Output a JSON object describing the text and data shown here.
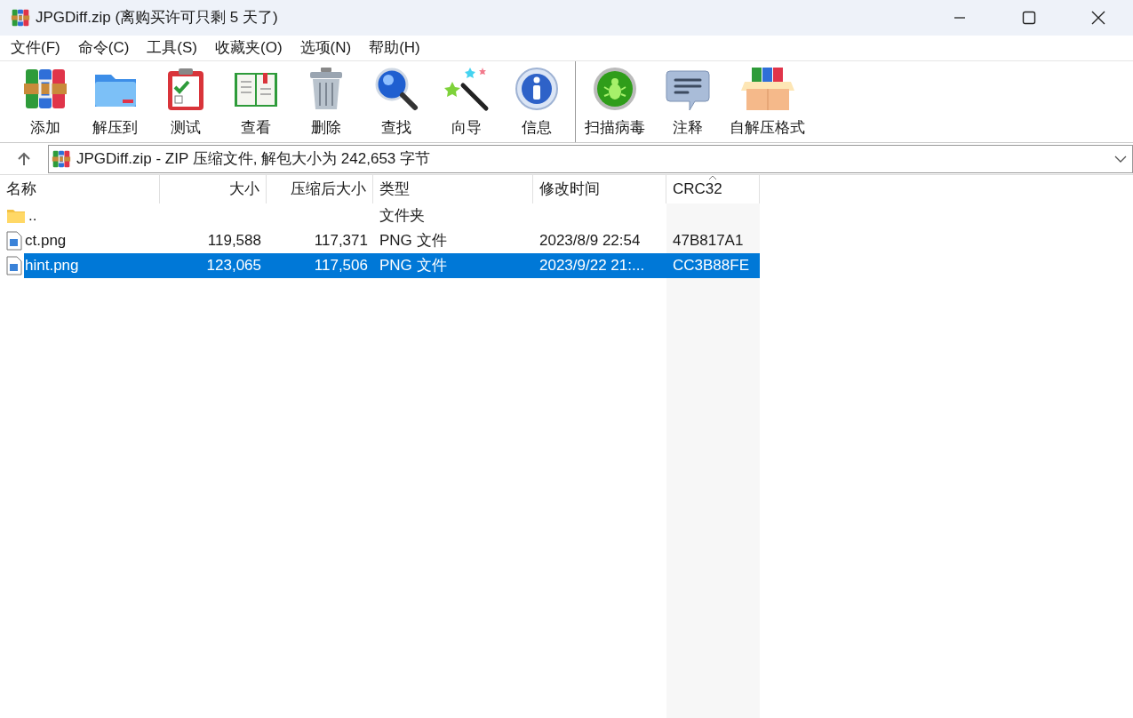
{
  "window": {
    "title": "JPGDiff.zip (离购买许可只剩 5 天了)"
  },
  "menu": [
    "文件(F)",
    "命令(C)",
    "工具(S)",
    "收藏夹(O)",
    "选项(N)",
    "帮助(H)"
  ],
  "toolbar_groups": [
    {
      "buttons": [
        {
          "label": "添加",
          "kind": "add"
        },
        {
          "label": "解压到",
          "kind": "extract"
        },
        {
          "label": "测试",
          "kind": "test"
        },
        {
          "label": "查看",
          "kind": "view"
        },
        {
          "label": "删除",
          "kind": "delete"
        },
        {
          "label": "查找",
          "kind": "find"
        },
        {
          "label": "向导",
          "kind": "wizard"
        },
        {
          "label": "信息",
          "kind": "info"
        }
      ]
    },
    {
      "buttons": [
        {
          "label": "扫描病毒",
          "kind": "virus"
        },
        {
          "label": "注释",
          "kind": "comment"
        },
        {
          "label": "自解压格式",
          "kind": "sfx"
        }
      ]
    }
  ],
  "address": {
    "text": "JPGDiff.zip - ZIP 压缩文件, 解包大小为 242,653 字节"
  },
  "table": {
    "columns": [
      {
        "label": "名称",
        "sorted": false
      },
      {
        "label": "大小",
        "sorted": false
      },
      {
        "label": "压缩后大小",
        "sorted": false
      },
      {
        "label": "类型",
        "sorted": false
      },
      {
        "label": "修改时间",
        "sorted": false
      },
      {
        "label": "CRC32",
        "sorted": true
      }
    ],
    "rows": [
      {
        "kind": "folder",
        "selected": false,
        "cells": [
          "..",
          "",
          "",
          "文件夹",
          "",
          ""
        ]
      },
      {
        "kind": "file",
        "selected": false,
        "cells": [
          "ct.png",
          "119,588",
          "117,371",
          "PNG 文件",
          "2023/8/9 22:54",
          "47B817A1"
        ]
      },
      {
        "kind": "file",
        "selected": true,
        "cells": [
          "hint.png",
          "123,065",
          "117,506",
          "PNG 文件",
          "2023/9/22 21:...",
          "CC3B88FE"
        ]
      }
    ]
  }
}
